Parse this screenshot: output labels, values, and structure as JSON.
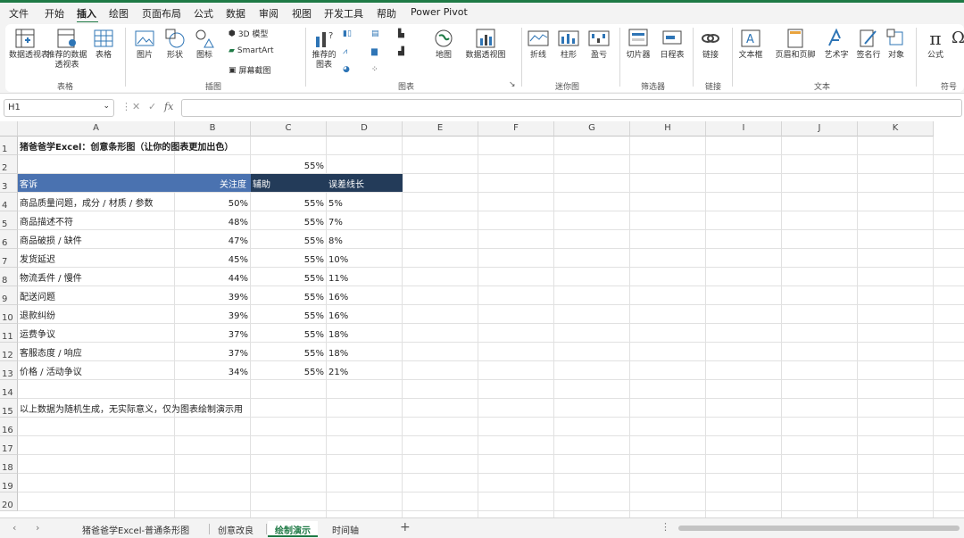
{
  "menu": [
    "文件",
    "开始",
    "插入",
    "绘图",
    "页面布局",
    "公式",
    "数据",
    "审阅",
    "视图",
    "开发工具",
    "帮助",
    "Power Pivot"
  ],
  "menu_active": "插入",
  "ribbon": {
    "tables": {
      "pivot": "数据透视表",
      "rec_pivot": "推荐的数据透视表",
      "table": "表格",
      "group": "表格"
    },
    "illustrations": {
      "pictures": "图片",
      "shapes": "形状",
      "icons": "图标",
      "models3d": "3D 模型",
      "smartart": "SmartArt",
      "screenshot": "屏幕截图",
      "group": "插图"
    },
    "charts": {
      "rec_charts": "推荐的图表",
      "maps": "地图",
      "pivot_chart": "数据透视图",
      "group": "图表"
    },
    "sparklines": {
      "line": "折线",
      "column": "柱形",
      "winloss": "盈亏",
      "group": "迷你图"
    },
    "filters": {
      "slicer": "切片器",
      "timeline": "日程表",
      "group": "筛选器"
    },
    "links": {
      "link": "链接",
      "group": "链接"
    },
    "text": {
      "textbox": "文本框",
      "header_footer": "页眉和页脚",
      "wordart": "艺术字",
      "signature": "签名行",
      "object": "对象",
      "group": "文本"
    },
    "symbols": {
      "equation": "公式",
      "group": "符号"
    }
  },
  "namebox": "H1",
  "fx_label": "fx",
  "columns": [
    "A",
    "B",
    "C",
    "D",
    "E",
    "F",
    "G",
    "H",
    "I",
    "J",
    "K"
  ],
  "rows": [
    "1",
    "2",
    "3",
    "4",
    "5",
    "6",
    "7",
    "8",
    "9",
    "10",
    "11",
    "12",
    "13",
    "14",
    "15",
    "16",
    "17",
    "18",
    "19",
    "20"
  ],
  "sheet": {
    "title": "猪爸爸学Excel：创意条形图（让你的图表更加出色）",
    "c2": "55%",
    "headers": [
      "客诉",
      "关注度",
      "辅助",
      "误差线长"
    ],
    "data": [
      [
        "商品质量问题，成分 / 材质 / 参数",
        "50%",
        "55%",
        "5%"
      ],
      [
        "商品描述不符",
        "48%",
        "55%",
        "7%"
      ],
      [
        "商品破损 / 缺件",
        "47%",
        "55%",
        "8%"
      ],
      [
        "发货延迟",
        "45%",
        "55%",
        "10%"
      ],
      [
        "物流丢件 / 慢件",
        "44%",
        "55%",
        "11%"
      ],
      [
        "配送问题",
        "39%",
        "55%",
        "16%"
      ],
      [
        "退款纠纷",
        "39%",
        "55%",
        "16%"
      ],
      [
        "运费争议",
        "37%",
        "55%",
        "18%"
      ],
      [
        "客服态度 / 响应",
        "37%",
        "55%",
        "18%"
      ],
      [
        "价格 / 活动争议",
        "34%",
        "55%",
        "21%"
      ]
    ],
    "note": "以上数据为随机生成，无实际意义，仅为图表绘制演示用"
  },
  "tabs": [
    "猪爸爸学Excel-普通条形图",
    "创意改良",
    "绘制演示",
    "时间轴"
  ],
  "active_tab": "绘制演示",
  "colors": {
    "accent": "#1e7a45",
    "header_blue": "#4a72b0",
    "header_navy": "#233b59"
  }
}
